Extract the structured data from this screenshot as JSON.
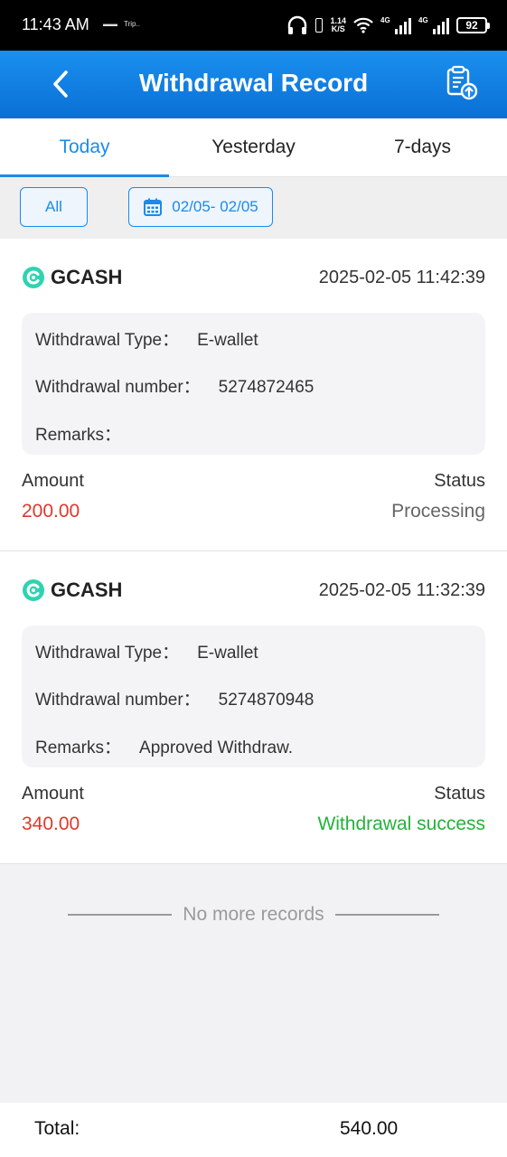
{
  "status_bar": {
    "time": "11:43 AM",
    "mini_left": "▬▬",
    "mini_app": "Trip..",
    "net_speed_value": "1.14",
    "net_speed_unit": "K/S",
    "net1": "4G",
    "net2": "4G",
    "battery": "92"
  },
  "header": {
    "title": "Withdrawal Record"
  },
  "tabs": [
    {
      "label": "Today",
      "active": true
    },
    {
      "label": "Yesterday",
      "active": false
    },
    {
      "label": "7-days",
      "active": false
    }
  ],
  "filters": {
    "all_label": "All",
    "date_range": "02/05- 02/05"
  },
  "labels": {
    "type": "Withdrawal Type：",
    "number": "Withdrawal number：",
    "remarks": "Remarks：",
    "amount": "Amount",
    "status": "Status"
  },
  "records": [
    {
      "channel": "GCASH",
      "datetime": "2025-02-05 11:42:39",
      "type": "E-wallet",
      "number": "5274872465",
      "remarks": "",
      "amount": "200.00",
      "status": "Processing"
    },
    {
      "channel": "GCASH",
      "datetime": "2025-02-05 11:32:39",
      "type": "E-wallet",
      "number": "5274870948",
      "remarks": "Approved Withdraw.",
      "amount": "340.00",
      "status": "Withdrawal success"
    }
  ],
  "end_text": "No more records",
  "total": {
    "label": "Total:",
    "value": "540.00"
  },
  "colors": {
    "accent": "#1a8bea",
    "amount": "#e0382b",
    "success": "#22b33a",
    "gcash": "#2fd3b1"
  }
}
